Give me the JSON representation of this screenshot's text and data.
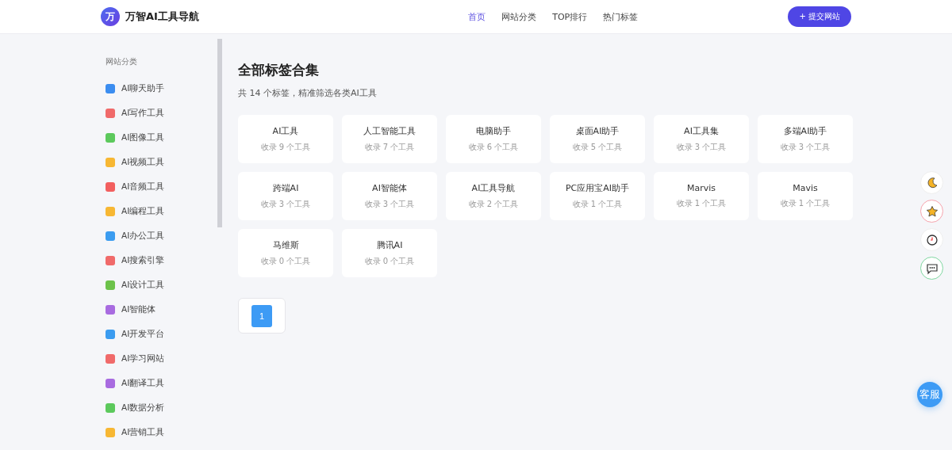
{
  "header": {
    "logo_letter": "万",
    "site_name": "万智AI工具导航",
    "nav": [
      {
        "label": "首页",
        "selected": true
      },
      {
        "label": "网站分类",
        "selected": false
      },
      {
        "label": "TOP排行",
        "selected": false
      },
      {
        "label": "热门标签",
        "selected": false
      }
    ],
    "submit_button": "+ 提交网站"
  },
  "sidebar": {
    "title": "网站分类",
    "items": [
      {
        "label": "AI聊天助手",
        "color": "#3b8df0"
      },
      {
        "label": "AI写作工具",
        "color": "#f06a6a"
      },
      {
        "label": "AI图像工具",
        "color": "#5cc95c"
      },
      {
        "label": "AI视频工具",
        "color": "#f7b733"
      },
      {
        "label": "AI音频工具",
        "color": "#f25f5f"
      },
      {
        "label": "AI编程工具",
        "color": "#f7b733"
      },
      {
        "label": "AI办公工具",
        "color": "#3b9cf0"
      },
      {
        "label": "AI搜索引擎",
        "color": "#f06a6a"
      },
      {
        "label": "AI设计工具",
        "color": "#6cc24a"
      },
      {
        "label": "AI智能体",
        "color": "#a86be0"
      },
      {
        "label": "AI开发平台",
        "color": "#3b9cf0"
      },
      {
        "label": "AI学习网站",
        "color": "#f06a6a"
      },
      {
        "label": "AI翻译工具",
        "color": "#a86be0"
      },
      {
        "label": "AI数据分析",
        "color": "#5cc95c"
      },
      {
        "label": "AI营销工具",
        "color": "#f7b733"
      }
    ]
  },
  "main": {
    "title": "全部标签合集",
    "subtitle": "共 14 个标签，精准筛选各类AI工具",
    "tags": [
      {
        "name": "AI工具",
        "count": "收录 9 个工具"
      },
      {
        "name": "人工智能工具",
        "count": "收录 7 个工具"
      },
      {
        "name": "电脑助手",
        "count": "收录 6 个工具"
      },
      {
        "name": "桌面AI助手",
        "count": "收录 5 个工具"
      },
      {
        "name": "AI工具集",
        "count": "收录 3 个工具"
      },
      {
        "name": "多端AI助手",
        "count": "收录 3 个工具"
      },
      {
        "name": "跨端AI",
        "count": "收录 3 个工具"
      },
      {
        "name": "AI智能体",
        "count": "收录 3 个工具"
      },
      {
        "name": "AI工具导航",
        "count": "收录 2 个工具"
      },
      {
        "name": "PC应用宝AI助手",
        "count": "收录 1 个工具"
      },
      {
        "name": "Marvis",
        "count": "收录 1 个工具"
      },
      {
        "name": "Mavis",
        "count": "收录 1 个工具"
      },
      {
        "name": "马维斯",
        "count": "收录 0 个工具"
      },
      {
        "name": "腾讯AI",
        "count": "收录 0 个工具"
      }
    ],
    "pagination": [
      {
        "label": "1",
        "selected": true
      }
    ]
  },
  "float_tools": [
    {
      "kind": "moon"
    },
    {
      "kind": "star"
    },
    {
      "kind": "clock"
    },
    {
      "kind": "chat"
    }
  ],
  "service_button": "客服"
}
